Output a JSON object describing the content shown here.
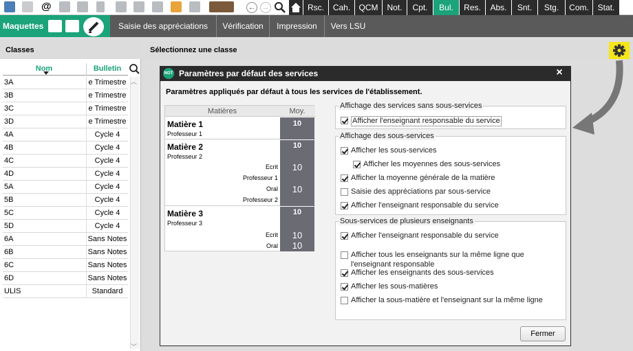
{
  "nav_tabs": [
    "Rsc.",
    "Cah.",
    "QCM",
    "Not.",
    "Cpt.",
    "Bul.",
    "Res.",
    "Abs.",
    "Snt.",
    "Stg.",
    "Com.",
    "Stat."
  ],
  "active_tab": "Bul.",
  "section": {
    "label": "Maquettes"
  },
  "sub_tabs": [
    "Saisie des appréciations",
    "Vérification",
    "Impression",
    "Vers LSU"
  ],
  "left": {
    "title": "Classes",
    "col_nom": "Nom",
    "col_bulletin": "Bulletin",
    "rows": [
      {
        "nom": "3A",
        "bulletin": "e Trimestre"
      },
      {
        "nom": "3B",
        "bulletin": "e Trimestre"
      },
      {
        "nom": "3C",
        "bulletin": "e Trimestre"
      },
      {
        "nom": "3D",
        "bulletin": "e Trimestre"
      },
      {
        "nom": "4A",
        "bulletin": "Cycle 4"
      },
      {
        "nom": "4B",
        "bulletin": "Cycle 4"
      },
      {
        "nom": "4C",
        "bulletin": "Cycle 4"
      },
      {
        "nom": "4D",
        "bulletin": "Cycle 4"
      },
      {
        "nom": "5A",
        "bulletin": "Cycle 4"
      },
      {
        "nom": "5B",
        "bulletin": "Cycle 4"
      },
      {
        "nom": "5C",
        "bulletin": "Cycle 4"
      },
      {
        "nom": "5D",
        "bulletin": "Cycle 4"
      },
      {
        "nom": "6A",
        "bulletin": "Sans Notes"
      },
      {
        "nom": "6B",
        "bulletin": "Sans Notes"
      },
      {
        "nom": "6C",
        "bulletin": "Sans Notes"
      },
      {
        "nom": "6D",
        "bulletin": "Sans Notes"
      },
      {
        "nom": "ULIS",
        "bulletin": "Standard"
      }
    ]
  },
  "right_header": "Sélectionnez une classe",
  "modal": {
    "badge": "NOT",
    "title": "Paramètres par défaut des services",
    "subtitle": "Paramètres appliqués par défaut à tous les services de l'établissement.",
    "preview": {
      "col_matieres": "Matières",
      "col_moy": "Moy.",
      "m1": {
        "name": "Matière 1",
        "prof": "Professeur 1",
        "moy": "10"
      },
      "m2": {
        "name": "Matière 2",
        "prof": "Professeur 2",
        "moy": "10",
        "s1": "Ecrit",
        "s1moy": "10",
        "p1": "Professeur 1",
        "s2": "Oral",
        "s2moy": "10",
        "p2": "Professeur 2"
      },
      "m3": {
        "name": "Matière 3",
        "prof": "Professeur 3",
        "moy": "10",
        "s1": "Ecrit",
        "s1moy": "10",
        "s2": "Oral",
        "s2moy": "10"
      }
    },
    "g1": {
      "title": "Affichage des services sans sous-services",
      "items": [
        {
          "label": "Afficher l'enseignant responsable du service",
          "checked": true
        }
      ]
    },
    "g2": {
      "title": "Affichage des sous-services",
      "items": [
        {
          "label": "Afficher les sous-services",
          "checked": true
        },
        {
          "label": "Afficher les moyennes des sous-services",
          "checked": true
        },
        {
          "label": "Afficher la moyenne générale de la matière",
          "checked": true
        },
        {
          "label": "Saisie des appréciations par sous-service",
          "checked": false
        },
        {
          "label": "Afficher l'enseignant responsable du service",
          "checked": true
        }
      ]
    },
    "g3": {
      "title": "Sous-services de plusieurs enseignants",
      "items": [
        {
          "label": "Afficher l'enseignant responsable du service",
          "checked": true
        },
        {
          "label": "Afficher tous les enseignants sur la même ligne que",
          "label2": "l'enseignant responsable",
          "checked": false
        },
        {
          "label": "Afficher les enseignants des sous-services",
          "checked": true
        },
        {
          "label": "Afficher les sous-matières",
          "checked": true
        },
        {
          "label": "Afficher la sous-matière et l'enseignant sur la même ligne",
          "checked": false
        }
      ]
    },
    "close_label": "Fermer"
  },
  "colors": {
    "accent": "#1ba37a",
    "dark": "#2b2b2b",
    "moy": "#6b6b74",
    "highlight": "#f5e61a"
  }
}
